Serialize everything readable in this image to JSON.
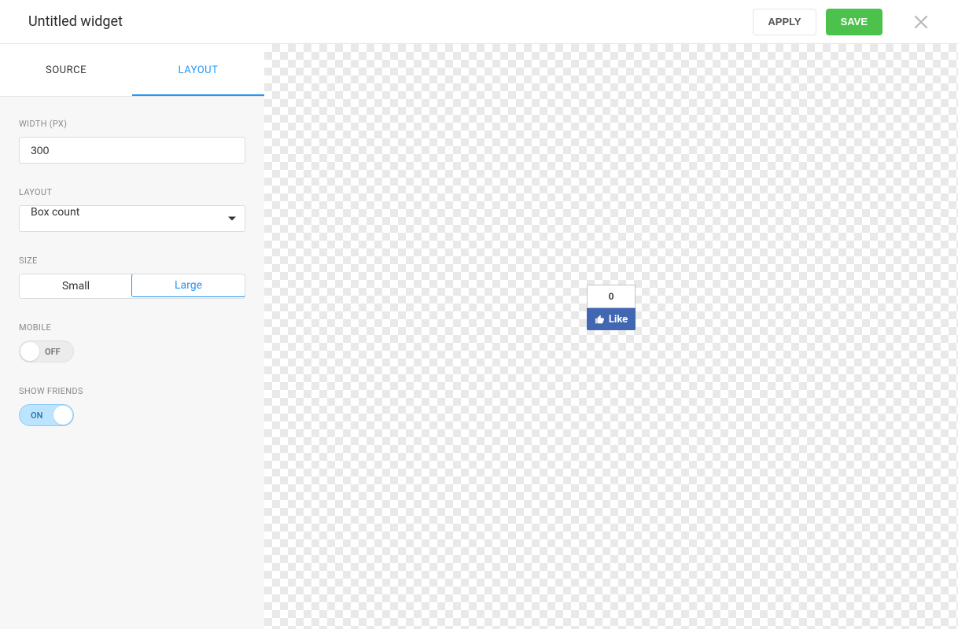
{
  "header": {
    "title": "Untitled widget",
    "apply_label": "APPLY",
    "save_label": "SAVE"
  },
  "tabs": {
    "source": "SOURCE",
    "layout": "LAYOUT"
  },
  "form": {
    "width_label": "WIDTH (PX)",
    "width_value": "300",
    "layout_label": "LAYOUT",
    "layout_value": "Box count",
    "size_label": "SIZE",
    "size_small": "Small",
    "size_large": "Large",
    "mobile_label": "MOBILE",
    "mobile_state": "OFF",
    "show_friends_label": "SHOW FRIENDS",
    "show_friends_state": "ON"
  },
  "preview": {
    "count": "0",
    "like_label": "Like"
  }
}
